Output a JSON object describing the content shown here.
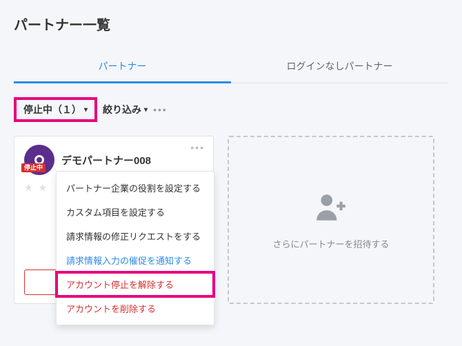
{
  "title": "パートナー一覧",
  "tabs": {
    "partner": "パートナー",
    "noLogin": "ログインなしパートナー"
  },
  "filters": {
    "status": "停止中（１）",
    "refine": "絞り込み"
  },
  "partner": {
    "name": "デモパートナー008",
    "badge": "停止中"
  },
  "menu": {
    "role": "パートナー企業の役割を設定する",
    "custom": "カスタム項目を設定する",
    "fixRequest": "請求情報の修正リクエストをする",
    "notify": "請求情報入力の催促を通知する",
    "unsuspend": "アカウント停止を解除する",
    "deletion": "アカウントを削除する"
  },
  "card": {
    "unsuspendBtn": "アカウント停止を解除する"
  },
  "invite": {
    "text": "さらにパートナーを招待する"
  }
}
